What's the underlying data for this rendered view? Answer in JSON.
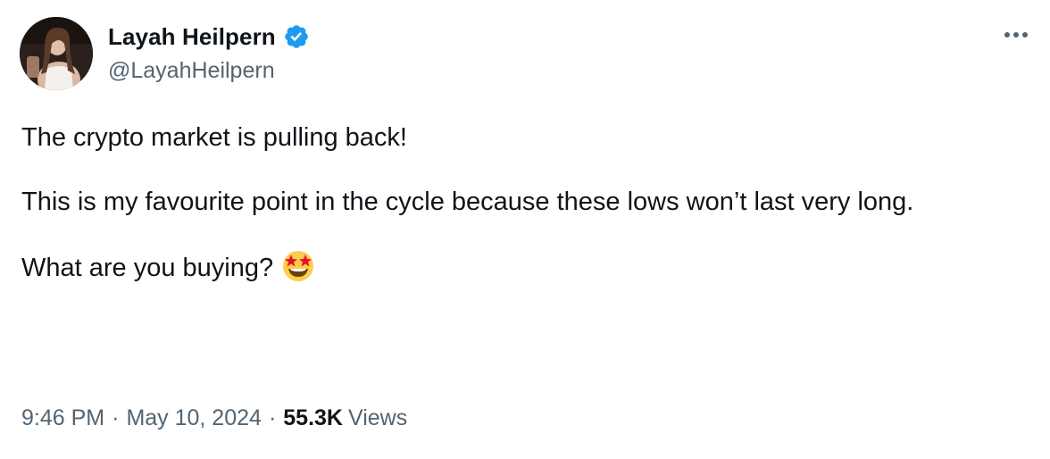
{
  "author": {
    "display_name": "Layah Heilpern",
    "handle": "@LayahHeilpern",
    "verified": true,
    "verified_icon": "verified-badge-icon",
    "verified_color": "#1d9bf0"
  },
  "more_icon": "more-horizontal-icon",
  "tweet": {
    "paragraphs": [
      "The crypto market is pulling back!",
      "This is my favourite point in the cycle because these lows won’t last very long.",
      "What are you buying?"
    ],
    "emoji": "star-struck-emoji"
  },
  "meta": {
    "time": "9:46 PM",
    "separator": "·",
    "date": "May 10, 2024",
    "views_count": "55.3K",
    "views_label": "Views"
  },
  "colors": {
    "text_primary": "#0f1419",
    "text_secondary": "#536471",
    "accent": "#1d9bf0"
  }
}
